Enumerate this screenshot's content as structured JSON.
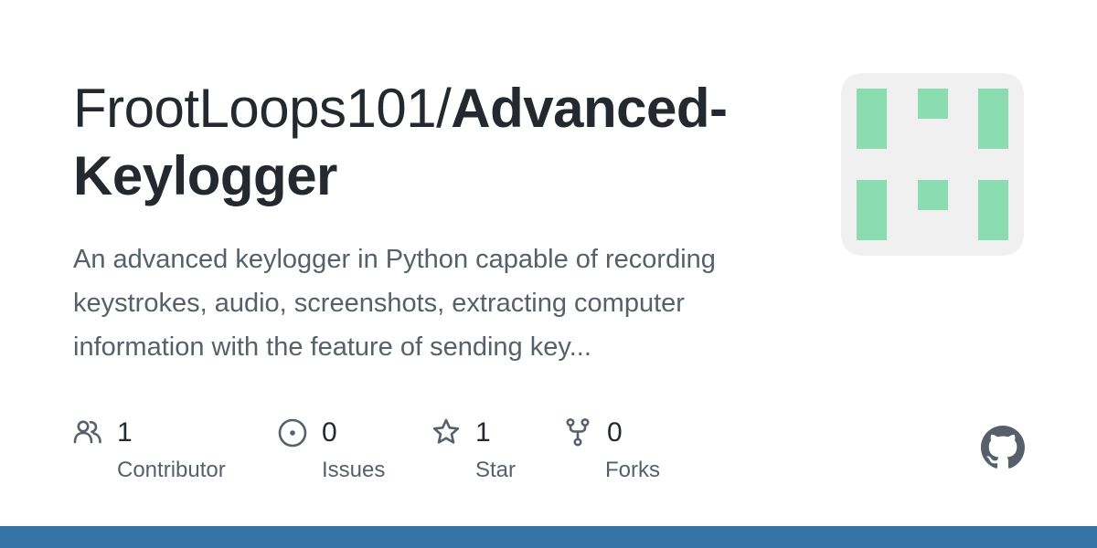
{
  "repo": {
    "owner_prefix": "FrootLoops101/",
    "name_line1": "Advanced-",
    "name_line2": "Keylogger",
    "description": "An advanced keylogger in Python capable of recording keystrokes, audio, screenshots, extracting computer information with the feature of sending key..."
  },
  "stats": {
    "contributors": {
      "count": "1",
      "label": "Contributor",
      "icon": "people-icon"
    },
    "issues": {
      "count": "0",
      "label": "Issues",
      "icon": "issue-opened-icon"
    },
    "stars": {
      "count": "1",
      "label": "Star",
      "icon": "star-icon"
    },
    "forks": {
      "count": "0",
      "label": "Forks",
      "icon": "repo-forked-icon"
    }
  },
  "avatar": {
    "background": "#f0f0f0",
    "block_color": "#8bdcb0"
  },
  "colors": {
    "title": "#24292f",
    "muted": "#57606a",
    "language_bar": "#3572a5",
    "github_mark": "#57606a"
  }
}
